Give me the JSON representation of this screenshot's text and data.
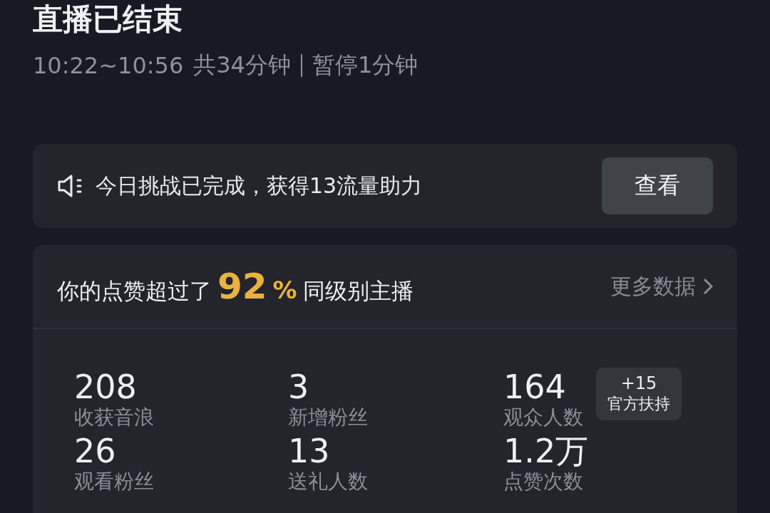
{
  "header": {
    "title": "直播已结束",
    "time_range": "10:22~10:56",
    "duration": "共34分钟",
    "pause": "暂停1分钟"
  },
  "notice": {
    "text": "今日挑战已完成，获得13流量助力",
    "button": "查看"
  },
  "summary": {
    "prefix": "你的点赞超过了",
    "percent": "92",
    "percent_sign": "%",
    "suffix": "同级别主播",
    "more_link": "更多数据"
  },
  "stats": [
    {
      "value": "208",
      "label": "收获音浪"
    },
    {
      "value": "3",
      "label": "新增粉丝"
    },
    {
      "value": "164",
      "label": "观众人数",
      "badge": {
        "value": "+15",
        "label": "官方扶持"
      }
    },
    {
      "value": "26",
      "label": "观看粉丝"
    },
    {
      "value": "13",
      "label": "送礼人数"
    },
    {
      "value": "1.2万",
      "label": "点赞次数"
    }
  ]
}
